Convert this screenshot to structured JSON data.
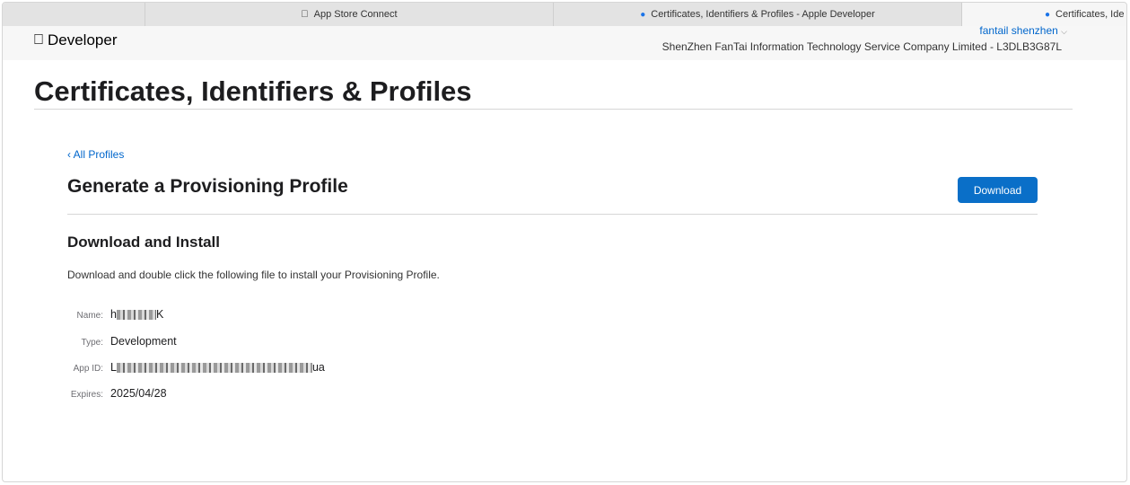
{
  "tabs": [
    {
      "label": ""
    },
    {
      "label": "App Store Connect"
    },
    {
      "label": "Certificates, Identifiers & Profiles - Apple Developer"
    },
    {
      "label": "Certificates, Ide"
    }
  ],
  "header": {
    "brand": "Developer",
    "user": "fantail shenzhen",
    "team": "ShenZhen FanTai Information Technology Service Company Limited - L3DLB3G87L"
  },
  "page": {
    "title": "Certificates, Identifiers & Profiles",
    "back_link": "‹ All Profiles",
    "section_title": "Generate a Provisioning Profile",
    "download_button": "Download",
    "subtitle": "Download and Install",
    "description": "Download and double click the following file to install your Provisioning Profile."
  },
  "details": {
    "name_label": "Name:",
    "name_value_start": "h",
    "name_value_end": "K",
    "type_label": "Type:",
    "type_value": "Development",
    "appid_label": "App ID:",
    "appid_value_start": "L",
    "appid_value_end": "ua",
    "expires_label": "Expires:",
    "expires_value": "2025/04/28"
  },
  "colors": {
    "link": "#0066cc",
    "button": "#0a6fc8"
  }
}
